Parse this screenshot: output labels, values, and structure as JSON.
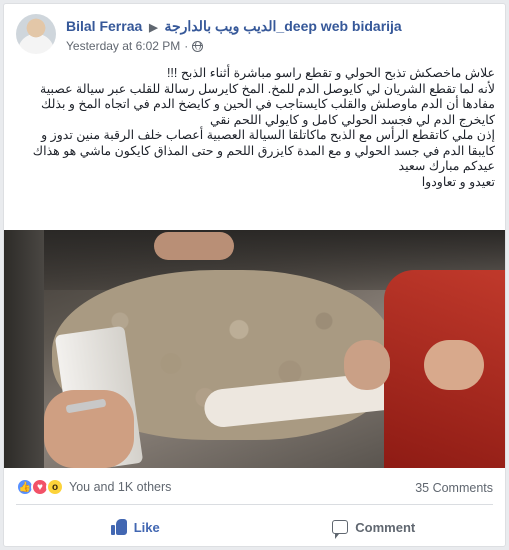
{
  "post": {
    "author": "Bilal Ferraa",
    "group": "deep web bidarija_الديب ويب بالدارجة",
    "timestamp": "Yesterday at 6:02 PM",
    "text_lines": [
      "علاش ماخصكش تذبح الحولي و تقطع راسو مباشرة أثناء الذبح !!!",
      "لأنه لما تقطع الشريان لي كايوصل الدم للمخ. المخ كايرسل رسالة للقلب عبر سيالة عصبية مفادها أن الدم ماوصلش والقلب كايستاجب في الحين و كايضخ الدم في اتجاه المخ و بذلك كايخرج الدم لي فجسد الحولي كامل و كايولي اللحم نقي",
      "إذن ملي كاتقطع الرأس مع الذبح ماكاتلقا السيالة العصبية أعصاب خلف الرقبة منين تدوز و كايبقا الدم في جسد الحولي و مع المدة كايزرق اللحم و حتى المذاق كايكون ماشي هو هذاك",
      "عيدكم مبارك سعيد",
      "تعيدو و تعاودوا"
    ]
  },
  "reactions": {
    "summary": "You and 1K others",
    "types": [
      "like",
      "love",
      "wow"
    ]
  },
  "comments": {
    "count_label": "35 Comments"
  },
  "actions": {
    "like_label": "Like",
    "comment_label": "Comment"
  },
  "colors": {
    "link_blue": "#365899",
    "like_blue": "#4267b2",
    "muted": "#606770"
  }
}
